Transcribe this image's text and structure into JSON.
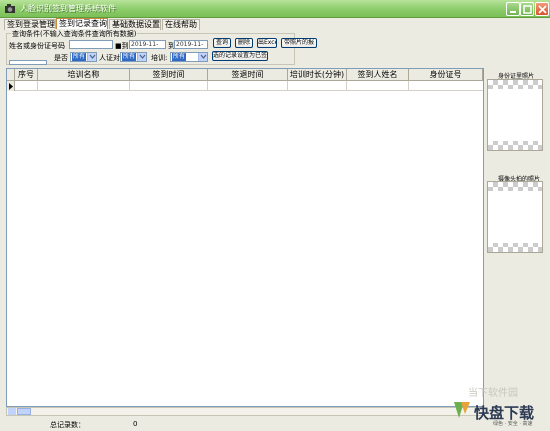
{
  "window": {
    "title": "人脸识别签到管理系统软件"
  },
  "menu": {
    "tabs": [
      {
        "label": "签到登录管理"
      },
      {
        "label": "签到记录查询"
      },
      {
        "label": "基础数据设置"
      },
      {
        "label": "在线帮助"
      }
    ],
    "active_index": 1
  },
  "search": {
    "legend": "查询条件(不输入查询条件查询所有数据)",
    "name_id_label": "姓名或身份证号码",
    "name_id_value": "",
    "date_from_label": "■到",
    "date_from_value": "2019-11-",
    "date_to_label": "到",
    "date_to_value": "2019-11-",
    "late_label": "是否",
    "late_value": "所有",
    "card_label": "人证对",
    "card_value": "所有",
    "training_label": "培训:",
    "training_value": "所有",
    "buttons": {
      "query": "查询",
      "delete": "删除",
      "export": "出Excel",
      "photo": "带照片的报",
      "set_signed": "选的记录设置为已签到"
    }
  },
  "table": {
    "columns": [
      "序号",
      "培训名称",
      "签到时间",
      "签退时间",
      "培训时长(分钟)",
      "签到人姓名",
      "身份证号"
    ],
    "rows": []
  },
  "right_panel": {
    "id_photo_label": "身份证里照片",
    "capture_photo_label": "摄像头拍的照片"
  },
  "status": {
    "total_label": "总记录数：",
    "total_value": "0"
  },
  "watermark": {
    "top": "当下软件园",
    "main": "快盘下载",
    "sub": "绿色 · 安全 · 高速"
  },
  "colors": {
    "titlebar": "#8ccc6a",
    "panel_bg": "#ecebe2",
    "selection": "#316ac5"
  }
}
